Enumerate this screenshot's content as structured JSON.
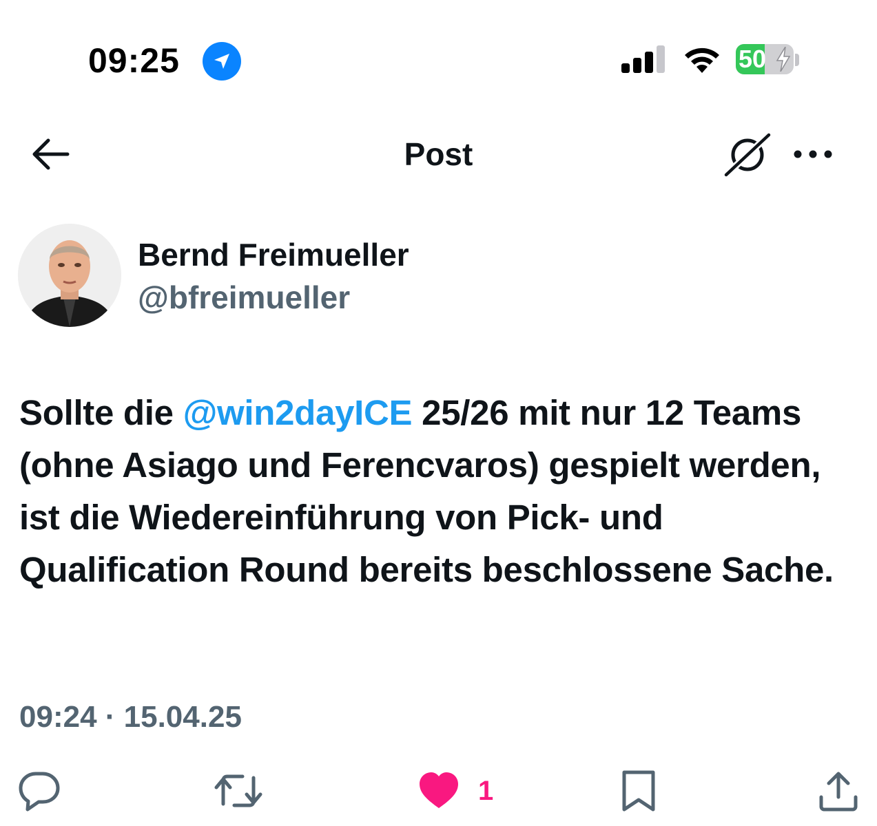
{
  "status_bar": {
    "time": "09:25",
    "battery_level": "50",
    "battery_fraction": 0.5,
    "location_icon": "location-arrow-icon",
    "signal_icon": "cellular-signal-icon",
    "wifi_icon": "wifi-icon",
    "battery_icon": "battery-charging-icon"
  },
  "header": {
    "title": "Post",
    "back_icon": "arrow-left-icon",
    "grok_icon": "grok-icon",
    "more_icon": "more-horizontal-icon"
  },
  "author": {
    "name": "Bernd Freimueller",
    "handle": "@bfreimueller"
  },
  "tweet": {
    "text_before": "Sollte die ",
    "mention": "@win2dayICE",
    "text_after": " 25/26 mit nur 12 Teams (ohne Asiago und Ferencvaros) gespielt werden, ist die Wiedereinführung von Pick- und Qualification Round bereits beschlossene Sache.",
    "meta": "09:24 · 15.04.25"
  },
  "actions": {
    "reply_icon": "reply-icon",
    "retweet_icon": "retweet-icon",
    "like_icon": "heart-filled-icon",
    "like_count": "1",
    "bookmark_icon": "bookmark-icon",
    "share_icon": "share-icon"
  },
  "colors": {
    "accent_blue": "#1d9bf0",
    "like_pink": "#f91880",
    "secondary_text": "#536471",
    "battery_green": "#34c759",
    "location_blue": "#0a84ff"
  }
}
